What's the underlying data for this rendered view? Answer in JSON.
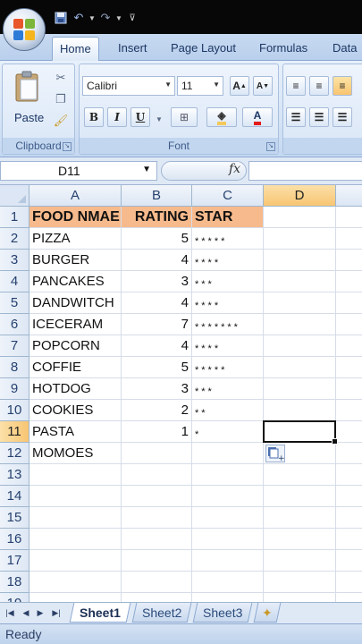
{
  "ribbon": {
    "tabs": [
      "Home",
      "Insert",
      "Page Layout",
      "Formulas",
      "Data"
    ],
    "active_tab": "Home",
    "clipboard": {
      "paste_label": "Paste",
      "group_label": "Clipboard"
    },
    "font": {
      "name": "Calibri",
      "size": "11",
      "group_label": "Font",
      "bold": "B",
      "italic": "I",
      "underline": "U",
      "grow": "A",
      "shrink": "A",
      "color_letter": "A"
    }
  },
  "formula_bar": {
    "name_box": "D11",
    "fx": "fx",
    "value": ""
  },
  "grid": {
    "columns": [
      "A",
      "B",
      "C",
      "D"
    ],
    "selected_column": "D",
    "selected_row": "11",
    "rows": [
      {
        "num": "1",
        "a": "FOOD NMAE",
        "b": "RATING",
        "c": "STAR"
      },
      {
        "num": "2",
        "a": "PIZZA",
        "b": "5",
        "c": "*****"
      },
      {
        "num": "3",
        "a": "BURGER",
        "b": "4",
        "c": "****"
      },
      {
        "num": "4",
        "a": "PANCAKES",
        "b": "3",
        "c": "***"
      },
      {
        "num": "5",
        "a": "DANDWITCH",
        "b": "4",
        "c": "****"
      },
      {
        "num": "6",
        "a": "ICECERAM",
        "b": "7",
        "c": "*******"
      },
      {
        "num": "7",
        "a": "POPCORN",
        "b": "4",
        "c": "****"
      },
      {
        "num": "8",
        "a": "COFFIE",
        "b": "5",
        "c": "*****"
      },
      {
        "num": "9",
        "a": "HOTDOG",
        "b": "3",
        "c": "***"
      },
      {
        "num": "10",
        "a": "COOKIES",
        "b": "2",
        "c": "**"
      },
      {
        "num": "11",
        "a": "PASTA",
        "b": "1",
        "c": "*"
      },
      {
        "num": "12",
        "a": "MOMOES",
        "b": "",
        "c": ""
      },
      {
        "num": "13",
        "a": "",
        "b": "",
        "c": ""
      },
      {
        "num": "14",
        "a": "",
        "b": "",
        "c": ""
      },
      {
        "num": "15",
        "a": "",
        "b": "",
        "c": ""
      },
      {
        "num": "16",
        "a": "",
        "b": "",
        "c": ""
      },
      {
        "num": "17",
        "a": "",
        "b": "",
        "c": ""
      },
      {
        "num": "18",
        "a": "",
        "b": "",
        "c": ""
      },
      {
        "num": "19",
        "a": "",
        "b": "",
        "c": ""
      }
    ]
  },
  "sheets": [
    "Sheet1",
    "Sheet2",
    "Sheet3"
  ],
  "active_sheet": "Sheet1",
  "status": "Ready",
  "colors": {
    "header_fill": "#f7ba8c",
    "selection_header": "#f8c573",
    "ribbon_blue": "#c8daf1"
  }
}
